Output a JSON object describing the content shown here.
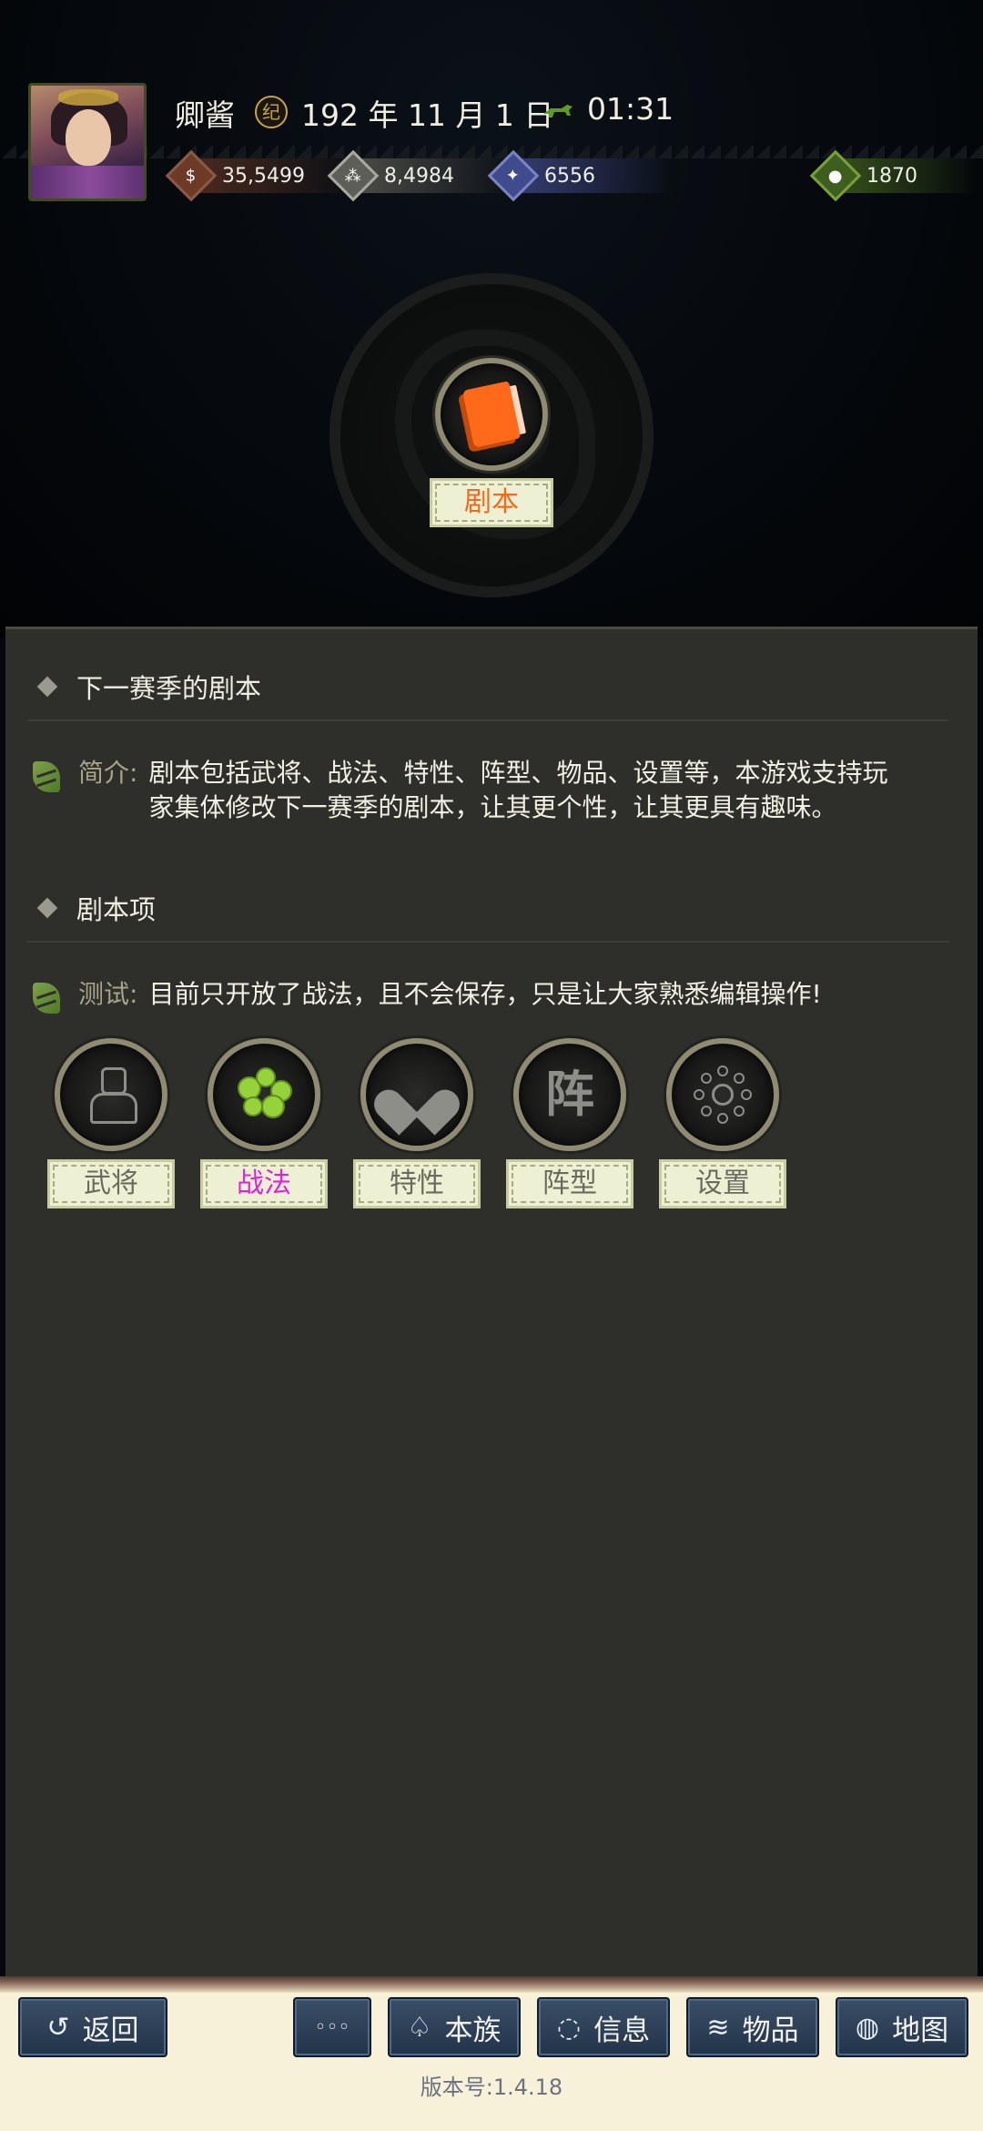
{
  "header": {
    "player_name": "卿酱",
    "year_icon": "year-seal-icon",
    "date": "192 年 11 月 1 日",
    "time": "01:31",
    "resources": [
      {
        "name": "money",
        "icon": "coin-icon",
        "value": "35,5499"
      },
      {
        "name": "grain",
        "icon": "grain-icon",
        "value": "8,4984"
      },
      {
        "name": "troops",
        "icon": "soldier-icon",
        "value": "6556"
      },
      {
        "name": "gold",
        "icon": "pouch-icon",
        "value": "1870"
      }
    ]
  },
  "feature": {
    "label": "剧本",
    "icon": "book-icon"
  },
  "panel": {
    "section1_title": "下一赛季的剧本",
    "intro_label": "简介:",
    "intro_text": "剧本包括武将、战法、特性、阵型、物品、设置等，本游戏支持玩家集体修改下一赛季的剧本，让其更个性，让其更具有趣味。",
    "section2_title": "剧本项",
    "test_label": "测试:",
    "test_text": "目前只开放了战法，且不会保存，只是让大家熟悉编辑操作!",
    "categories": [
      {
        "label": "武将",
        "icon": "general-icon",
        "active": false
      },
      {
        "label": "战法",
        "icon": "tactic-icon",
        "active": true
      },
      {
        "label": "特性",
        "icon": "trait-heart-icon",
        "active": false
      },
      {
        "label": "阵型",
        "icon": "formation-icon",
        "active": false
      },
      {
        "label": "设置",
        "icon": "settings-network-icon",
        "active": false
      }
    ]
  },
  "nav": {
    "back": "返回",
    "more": "◦◦◦",
    "clan": "本族",
    "info": "信息",
    "items": "物品",
    "map": "地图"
  },
  "version": "版本号:1.4.18",
  "colors": {
    "active_tab": "#e01fe0",
    "feature_label": "#f06a1c",
    "panel_bg": "#2e2f2a",
    "nav_button": "#2c3f56"
  }
}
